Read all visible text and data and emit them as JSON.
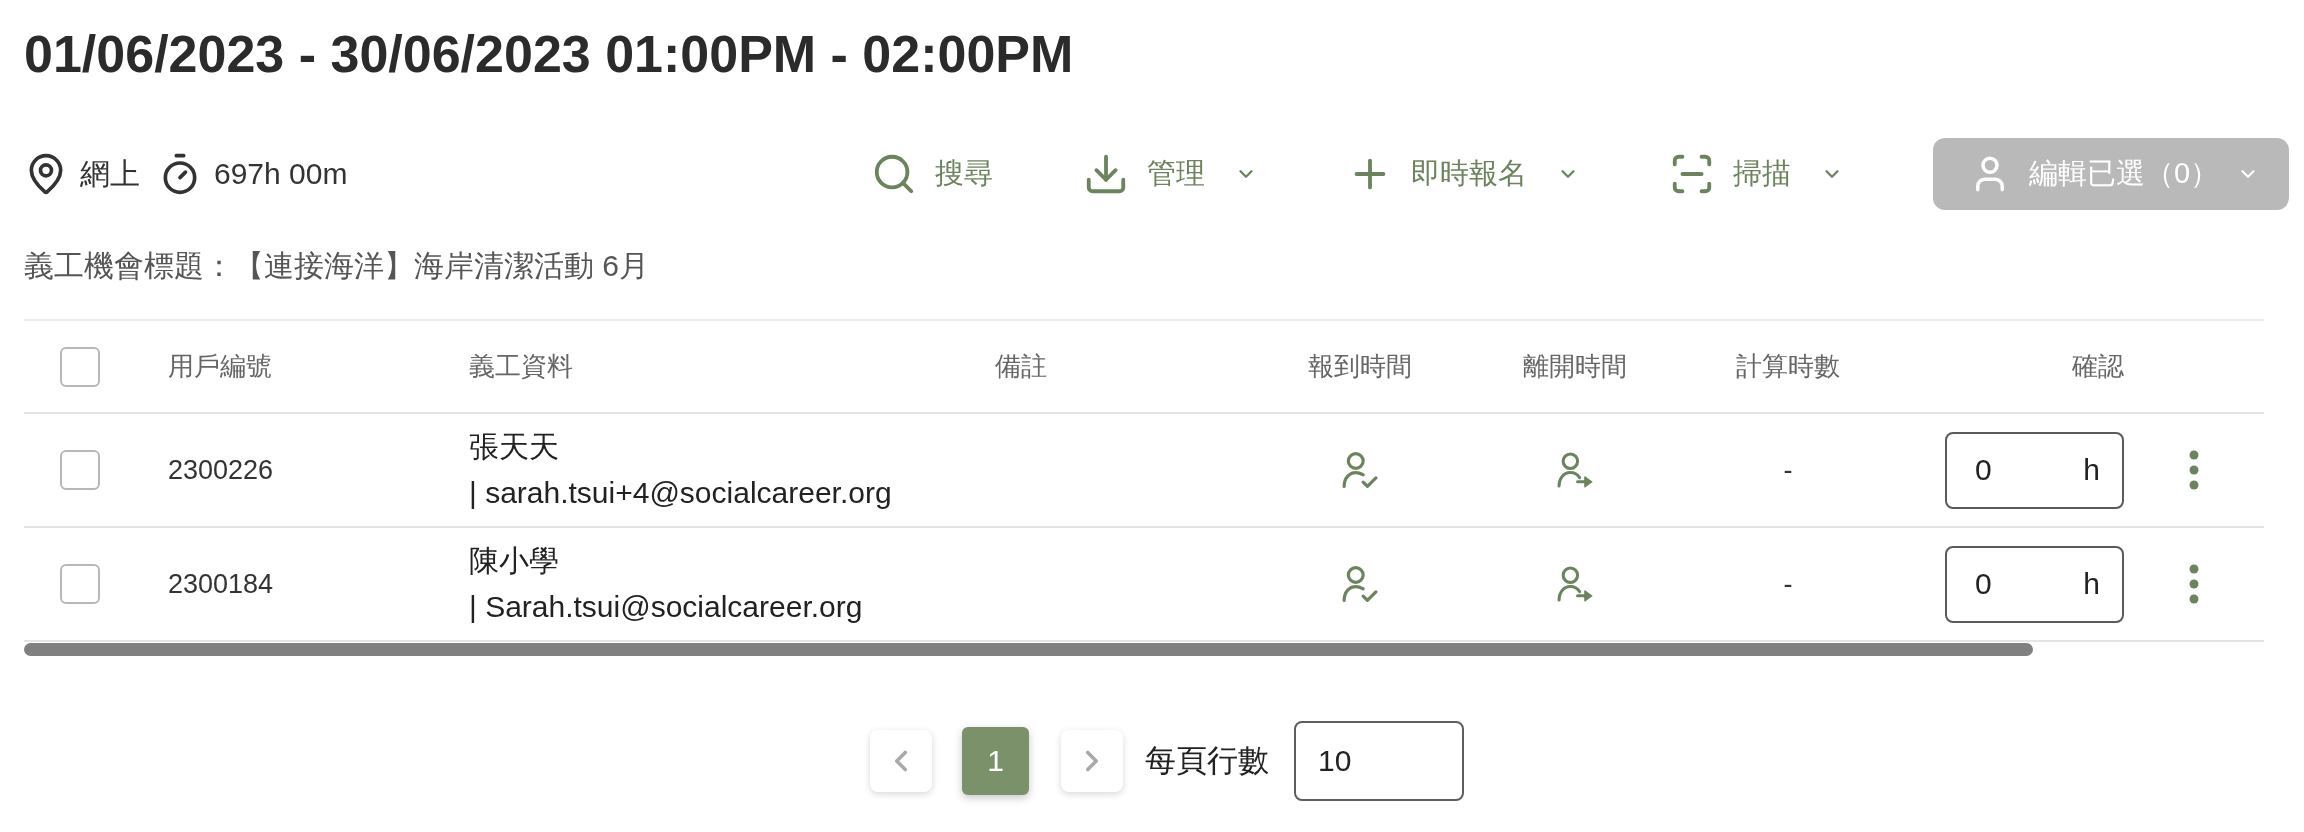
{
  "header": {
    "title": "01/06/2023 - 30/06/2023 01:00PM - 02:00PM"
  },
  "info": {
    "location": "網上",
    "duration": "697h 00m"
  },
  "toolbar": {
    "actions": [
      {
        "kind": "search",
        "label": "搜尋",
        "dropdown": false
      },
      {
        "kind": "download",
        "label": "管理",
        "dropdown": true
      },
      {
        "kind": "add",
        "label": "即時報名",
        "dropdown": true
      },
      {
        "kind": "scan",
        "label": "掃描",
        "dropdown": true
      }
    ],
    "edit_selected": {
      "label": "編輯已選（0）",
      "disabled": true,
      "dropdown": true
    }
  },
  "subtitle": "義工機會標題：【連接海洋】海岸清潔活動 6月",
  "table": {
    "select_all": {
      "checked": false
    },
    "columns": [
      "用戶編號",
      "義工資料",
      "備註",
      "報到時間",
      "離開時間",
      "計算時數",
      "確認"
    ],
    "rows": [
      {
        "checked": false,
        "id": "2300226",
        "name": "張天天",
        "email": "| sarah.tsui+4@socialcareer.org",
        "hours": "-",
        "confirm": {
          "value": "0",
          "unit": "h"
        }
      },
      {
        "checked": false,
        "id": "2300184",
        "name": "陳小學",
        "email": "| Sarah.tsui@socialcareer.org",
        "hours": "-",
        "confirm": {
          "value": "0",
          "unit": "h"
        }
      }
    ]
  },
  "pagination": {
    "pages": [
      {
        "label": "1",
        "selected": true
      }
    ],
    "rows_per_page_label": "每頁行數",
    "rows_per_page": "10"
  }
}
